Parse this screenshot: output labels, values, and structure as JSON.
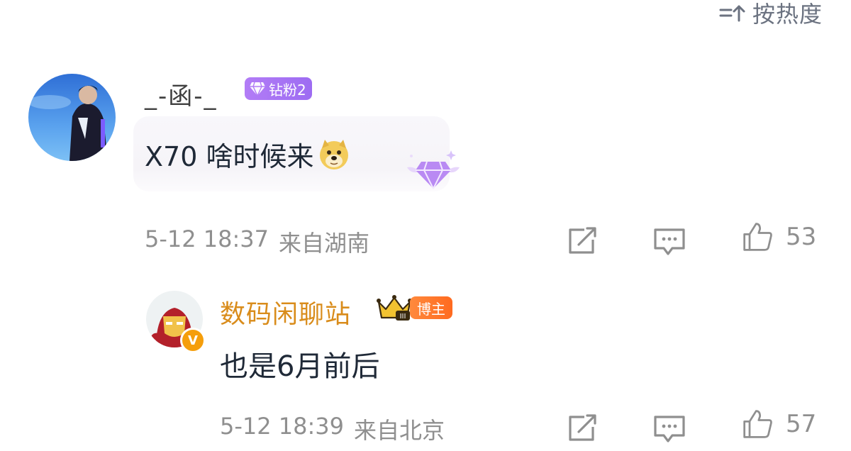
{
  "sort": {
    "label": "按热度",
    "icon": "sort-icon"
  },
  "comments": [
    {
      "username": "_-函-_",
      "fan_badge": "钻粉2",
      "text": "X70 啥时候来",
      "emoji": "doge-emoji",
      "time": "5-12 18:37",
      "location": "来自湖南",
      "likes": "53"
    }
  ],
  "reply": {
    "username": "数码闲聊站",
    "host_badge": "博主",
    "crown_level": "III",
    "verified": "V",
    "text": "也是6月前后",
    "time": "5-12 18:39",
    "location": "来自北京",
    "likes": "57"
  },
  "colors": {
    "gray_text": "#8f8f8f",
    "username_gold": "#d98c1b",
    "fan_badge_purple": "#a77bf5",
    "host_badge_orange": "#ff7a2a"
  },
  "icons": [
    "share-icon",
    "comment-icon",
    "like-icon",
    "diamond-icon",
    "crown-icon",
    "verified-icon"
  ]
}
